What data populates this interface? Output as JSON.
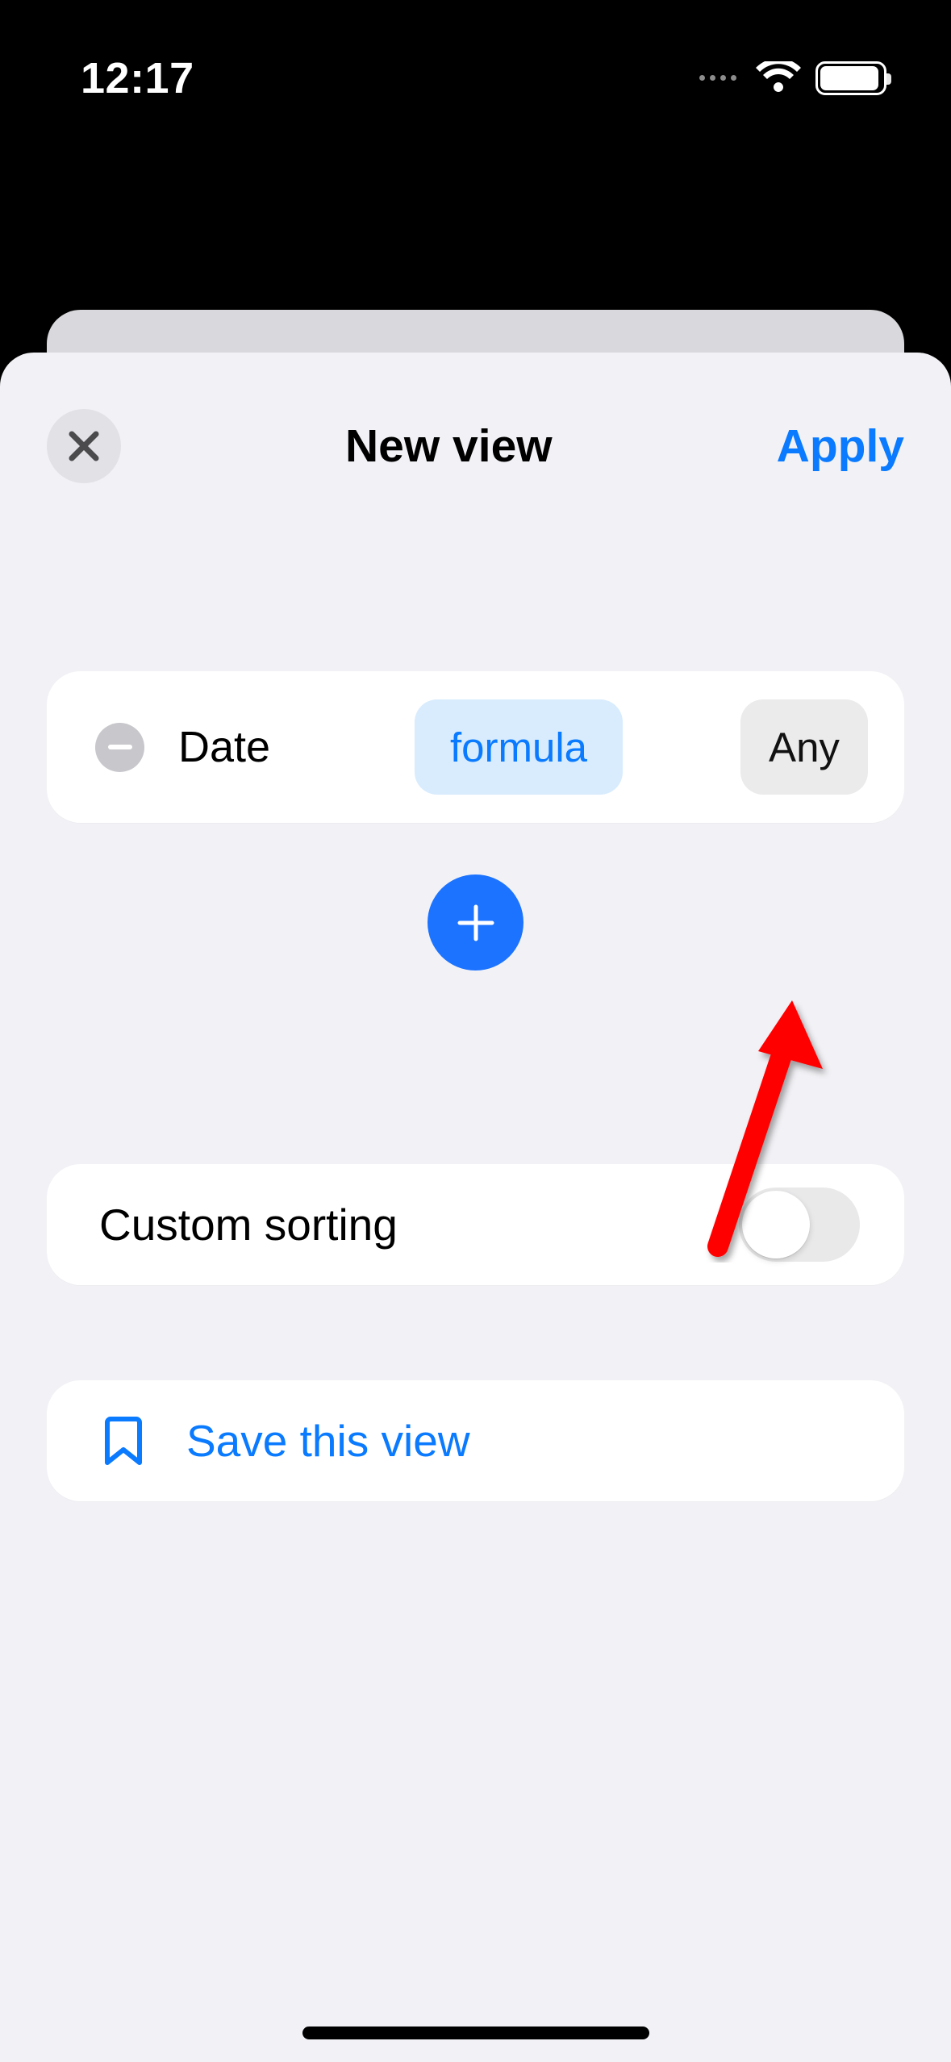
{
  "status": {
    "time": "12:17"
  },
  "sheet": {
    "title": "New view",
    "apply_label": "Apply"
  },
  "filter": {
    "field_label": "Date",
    "operator_chip": "formula",
    "value_chip": "Any"
  },
  "sorting": {
    "label": "Custom sorting",
    "enabled": false
  },
  "save": {
    "label": "Save this view"
  },
  "colors": {
    "accent": "#0a7aff"
  }
}
